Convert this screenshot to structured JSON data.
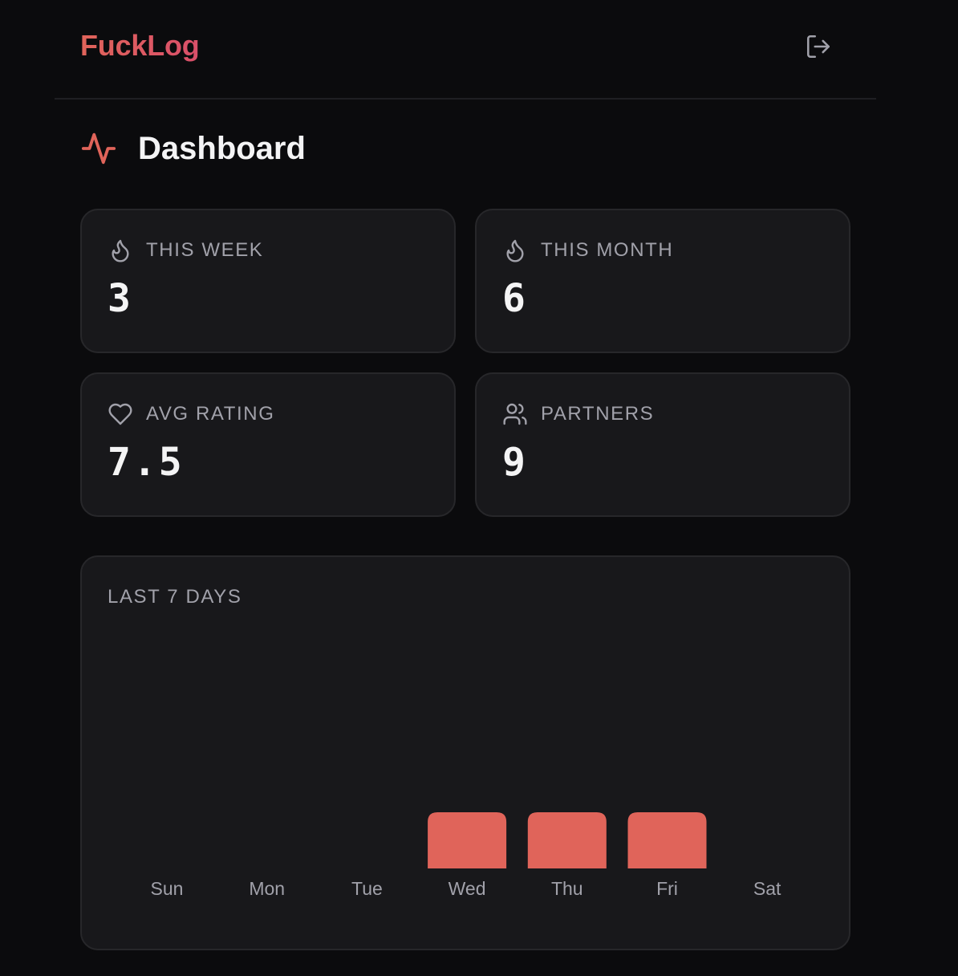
{
  "header": {
    "brand": "FuckLog",
    "logout_icon": "log-out-icon"
  },
  "page": {
    "title": "Dashboard",
    "title_icon": "activity-icon"
  },
  "stats": {
    "week": {
      "label": "THIS WEEK",
      "value": "3",
      "icon": "flame-icon"
    },
    "month": {
      "label": "THIS MONTH",
      "value": "6",
      "icon": "flame-icon"
    },
    "rating": {
      "label": "AVG RATING",
      "value": "7.5",
      "icon": "heart-icon"
    },
    "partners": {
      "label": "PARTNERS",
      "value": "9",
      "icon": "users-icon"
    }
  },
  "colors": {
    "accent": "#e0645a",
    "card_bg": "#18181b",
    "muted_text": "#a1a1aa"
  },
  "chart_data": {
    "type": "bar",
    "title": "LAST 7 DAYS",
    "categories": [
      "Sun",
      "Mon",
      "Tue",
      "Wed",
      "Thu",
      "Fri",
      "Sat"
    ],
    "values": [
      0,
      0,
      0,
      1,
      1,
      1,
      0
    ],
    "ylim": [
      0,
      4
    ],
    "grid": false,
    "bar_color": "#e0645a"
  }
}
